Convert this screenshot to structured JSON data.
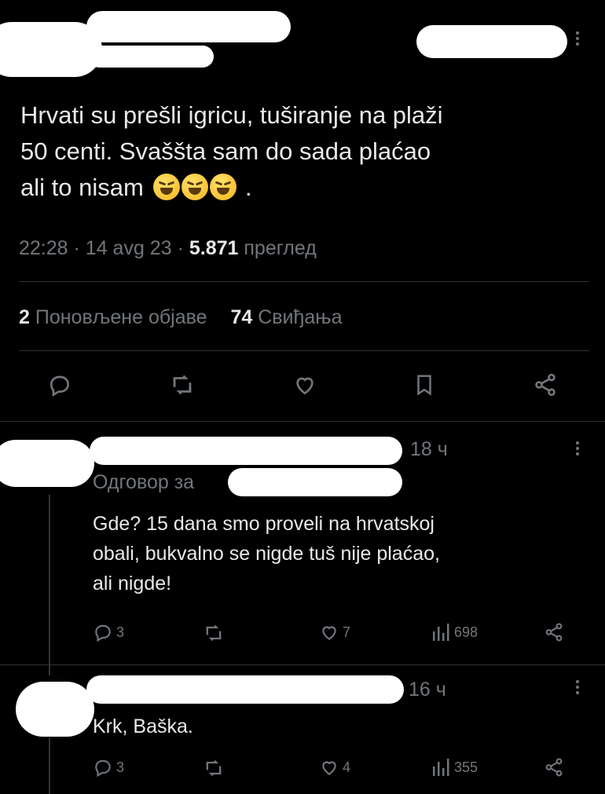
{
  "tweet": {
    "text_line1": "Hrvati su prešli igricu, tuširanje na plaži",
    "text_line2": "50 centi. Svaššta sam do sada plaćao",
    "text_line3": "ali to nisam",
    "text_suffix": ".",
    "emoji_count": 3,
    "time": "22:28",
    "date": "14 avg 23",
    "views": "5.871",
    "views_label": "преглед",
    "reposts": "2",
    "reposts_label": "Поновљене објаве",
    "likes": "74",
    "likes_label": "Свиђања"
  },
  "actions": {
    "icons": [
      "reply-icon",
      "retweet-icon",
      "like-icon",
      "bookmark-icon",
      "share-icon"
    ]
  },
  "replies": [
    {
      "time": "18 ч",
      "replying_to_label": "Одговор за",
      "text_line1": "Gde? 15 dana smo proveli na hrvatskoj",
      "text_line2": "obali, bukvalno se nigde tuš nije plaćao,",
      "text_line3": "ali nigde!",
      "reply_count": "3",
      "like_count": "7",
      "view_count": "698"
    },
    {
      "time": "16 ч",
      "text_line1": "Krk, Baška.",
      "reply_count": "3",
      "like_count": "4",
      "view_count": "355"
    }
  ],
  "colors": {
    "background": "#000000",
    "text": "#e7e9ea",
    "muted": "#71767b",
    "divider": "#2f3336"
  }
}
